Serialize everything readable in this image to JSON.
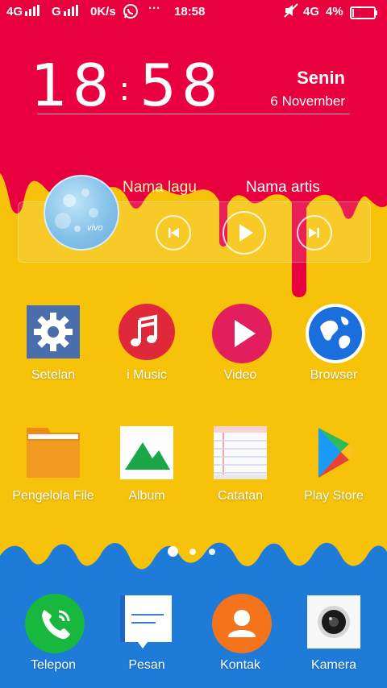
{
  "status_bar": {
    "signal1": "4G",
    "signal2": "G",
    "speed": "0K/s",
    "more": "···",
    "time": "18:58",
    "network": "4G",
    "battery": "4%",
    "icons": [
      "signal-icon",
      "whatsapp-icon",
      "mute-icon",
      "battery-icon"
    ]
  },
  "clock": {
    "hours": "18",
    "minutes": "58",
    "day": "Senin",
    "date": "6 November"
  },
  "music": {
    "song": "Nama lagu",
    "artist": "Nama artis",
    "album_brand": "vivo"
  },
  "apps": [
    {
      "label": "Setelan",
      "icon": "gear-icon"
    },
    {
      "label": "i Music",
      "icon": "music-note-icon"
    },
    {
      "label": "Video",
      "icon": "play-icon"
    },
    {
      "label": "Browser",
      "icon": "globe-icon"
    },
    {
      "label": "Pengelola File",
      "icon": "folder-icon"
    },
    {
      "label": "Album",
      "icon": "mountain-icon"
    },
    {
      "label": "Catatan",
      "icon": "notepad-icon"
    },
    {
      "label": "Play Store",
      "icon": "play-store-icon"
    }
  ],
  "dock": [
    {
      "label": "Telepon",
      "icon": "phone-icon"
    },
    {
      "label": "Pesan",
      "icon": "message-icon"
    },
    {
      "label": "Kontak",
      "icon": "contact-icon"
    },
    {
      "label": "Kamera",
      "icon": "camera-icon"
    }
  ],
  "colors": {
    "top": "#e8003f",
    "middle": "#f7c30a",
    "bottom": "#1f7bd8"
  },
  "page_indicator": {
    "pages": 3,
    "current": 1
  }
}
